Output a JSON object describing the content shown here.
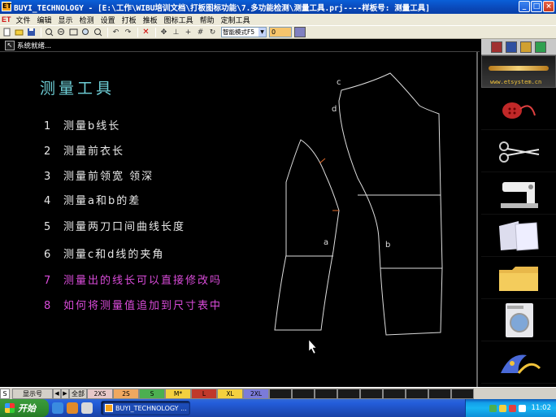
{
  "window": {
    "title": "BUYI_TECHNOLOGY - [E:\\工作\\WIBU培训文档\\打板图标功能\\7.多功能检测\\测量工具.prj----样板号: 测量工具]",
    "icon_text": "ET"
  },
  "menu": {
    "brand": "ET",
    "items": [
      "文件",
      "编辑",
      "显示",
      "检测",
      "设置",
      "打板",
      "推板",
      "图标工具",
      "帮助",
      "定制工具"
    ]
  },
  "toolbar": {
    "mode_select": "智能模式F5",
    "number_value": "0"
  },
  "status": {
    "text": "系统就绪..."
  },
  "canvas": {
    "heading": "测量工具",
    "tips": [
      {
        "num": "1",
        "text": "测量b线长",
        "color": "white"
      },
      {
        "num": "2",
        "text": "测量前衣长",
        "color": "white"
      },
      {
        "num": "3",
        "text": "测量前领宽   领深",
        "color": "white"
      },
      {
        "num": "4",
        "text": "测量a和b的差",
        "color": "white"
      },
      {
        "num": "5",
        "text": "测量两刀口间曲线长度",
        "color": "white"
      },
      {
        "num": "6",
        "text": "测量c和d线的夹角",
        "color": "white"
      },
      {
        "num": "7",
        "text": "测量出的线长可以直接修改吗",
        "color": "magenta"
      },
      {
        "num": "8",
        "text": "如何将测量值追加到尺寸表中",
        "color": "magenta"
      }
    ],
    "labels": {
      "c": "c",
      "d": "d",
      "a": "a",
      "b": "b"
    },
    "colors": {
      "heading": "#6fd0d8",
      "tip_white": "#e8e8e8",
      "tip_magenta": "#d94bd9",
      "notch": "#e06a2a"
    }
  },
  "right_panel": {
    "url": "www.etsystem.cn",
    "items": [
      "button-thread-icon",
      "scissors-icon",
      "sewing-machine-icon",
      "paper-pattern-icon",
      "folder-icon",
      "washing-machine-icon",
      "tailor-logo-icon"
    ]
  },
  "sizebar": {
    "s_label": "S",
    "display_label": "显示号",
    "all_label": "全部",
    "sizes": [
      {
        "name": "2XS",
        "color": "#e8c8c8"
      },
      {
        "name": "2S",
        "color": "#f0a860"
      },
      {
        "name": "S",
        "color": "#4caf50"
      },
      {
        "name": "M*",
        "color": "#f4d03f"
      },
      {
        "name": "L",
        "color": "#c0392b"
      },
      {
        "name": "XL",
        "color": "#f4d03f"
      },
      {
        "name": "2XL",
        "color": "#7b7bd9"
      }
    ]
  },
  "taskbar": {
    "start": "开始",
    "task": "BUYI_TECHNOLOGY ...",
    "clock": "11:02"
  }
}
